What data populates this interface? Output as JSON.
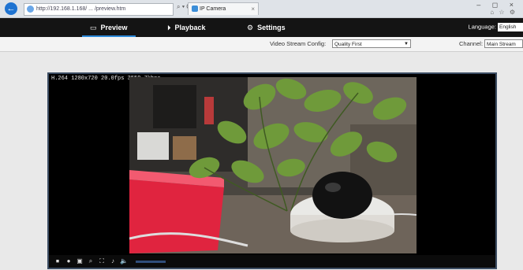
{
  "browser": {
    "url": "http://192.168.1.168/ ... /preview.htm",
    "address_controls": "⌕ ▾ C",
    "tab_title": "IP Camera",
    "tab_close": "×",
    "window_controls": "–  ◻  ×",
    "toolbar_icons": "⌂ ☆ ⚙"
  },
  "nav": {
    "items": [
      {
        "label": "Preview",
        "icon": "monitor-icon",
        "glyph": "▭"
      },
      {
        "label": "Playback",
        "icon": "playback-icon",
        "glyph": "⏵"
      },
      {
        "label": "Settings",
        "icon": "settings-icon",
        "glyph": "⚙"
      }
    ],
    "language_label": "Language:",
    "language_value": "English"
  },
  "toolbar": {
    "stream_config_label": "Video Stream Config:",
    "stream_config_value": "Quality First",
    "channel_label": "Channel:",
    "channel_value": "Main Stream"
  },
  "player": {
    "osd": "H.264 1280x720 20.0fps 3559.7kbps",
    "controls": [
      {
        "name": "stop-icon",
        "glyph": "⏹"
      },
      {
        "name": "record-icon",
        "glyph": "●"
      },
      {
        "name": "snapshot-icon",
        "glyph": "▣"
      },
      {
        "name": "zoom-icon",
        "glyph": "⌕"
      },
      {
        "name": "fullscreen-icon",
        "glyph": "⛶"
      },
      {
        "name": "mic-icon",
        "glyph": "♪"
      },
      {
        "name": "volume-icon",
        "glyph": "🔈"
      }
    ]
  },
  "colors": {
    "nav_background": "#141414",
    "accent": "#2b88d8",
    "player_border": "#3c4d63"
  }
}
